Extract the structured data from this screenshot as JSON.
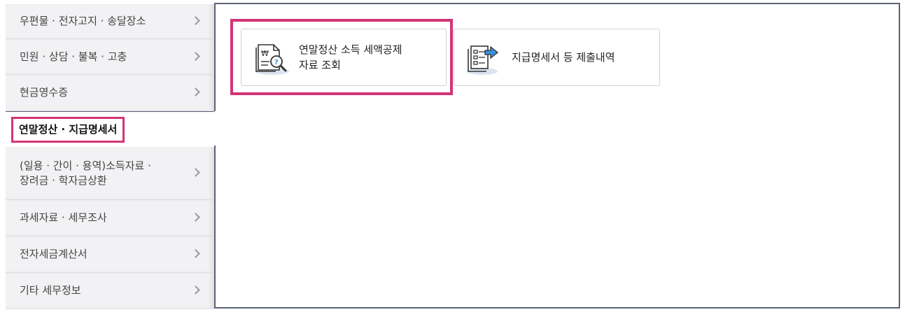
{
  "sidebar": {
    "items": [
      {
        "label": "우편물 · 전자고지 · 송달장소"
      },
      {
        "label": "민원 · 상담 · 불복 · 고충"
      },
      {
        "label": "현금영수증"
      },
      {
        "label": "연말정산 · 지급명세서"
      },
      {
        "label_line1": "(일용 · 간이 · 용역)소득자료 ·",
        "label_line2": "장려금 · 학자금상환"
      },
      {
        "label": "과세자료 · 세무조사"
      },
      {
        "label": "전자세금계산서"
      },
      {
        "label": "기타 세무정보"
      }
    ]
  },
  "cards": [
    {
      "line1": "연말정산 소득 세액공제",
      "line2": "자료 조회",
      "icon": "document-search-icon"
    },
    {
      "line1": "지급명세서 등 제출내역",
      "icon": "document-submit-icon"
    }
  ],
  "colors": {
    "highlight": "#d33477",
    "border": "#5c6275",
    "icon_accent": "#3b8fd9"
  }
}
